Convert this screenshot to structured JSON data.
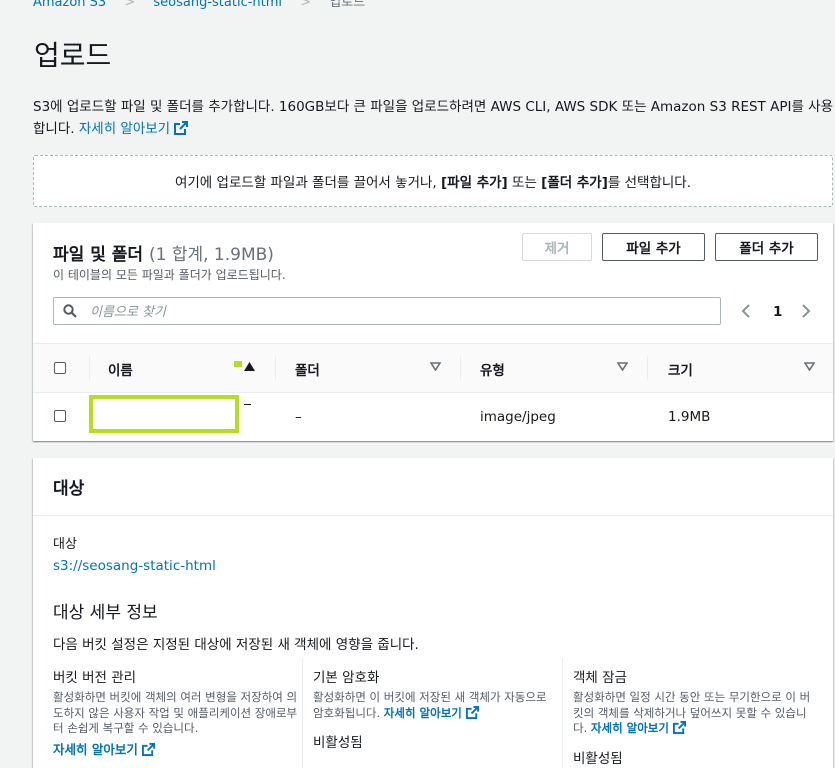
{
  "breadcrumb": {
    "root": "Amazon S3",
    "bucket": "seosang-static-html",
    "current": "업로드"
  },
  "page": {
    "title": "업로드",
    "intro_text": "S3에 업로드할 파일 및 폴더를 추가합니다. 160GB보다 큰 파일을 업로드하려면 AWS CLI, AWS SDK 또는 Amazon S3 REST API를 사용합니다.",
    "intro_link": "자세히 알아보기"
  },
  "dropzone": {
    "part1": "여기에 업로드할 파일과 폴더를 끌어서 놓거나, ",
    "add_files": "[파일 추가]",
    "part2": " 또는 ",
    "add_folder": "[폴더 추가]",
    "part3": "를 선택합니다."
  },
  "files": {
    "title": "파일 및 폴더",
    "count": "(1 합계, 1.9MB)",
    "description": "이 테이블의 모든 파일과 폴더가 업로드됩니다.",
    "buttons": {
      "remove": "제거",
      "add_files": "파일 추가",
      "add_folder": "폴더 추가"
    },
    "search_placeholder": "이름으로 찾기",
    "page": "1",
    "columns": {
      "name": "이름",
      "folder": "폴더",
      "type": "유형",
      "size": "크기"
    },
    "rows": [
      {
        "name": "",
        "folder": "–",
        "type": "image/jpeg",
        "size": "1.9MB"
      }
    ],
    "colors": {
      "highlight": "#b5de1f"
    }
  },
  "target": {
    "header": "대상",
    "label": "대상",
    "uri": "s3://seosang-static-html",
    "details_title": "대상 세부 정보",
    "details_desc": "다음 버킷 설정은 지정된 대상에 저장된 새 객체에 영향을 줍니다.",
    "versioning": {
      "title": "버킷 버전 관리",
      "desc": "활성화하면 버킷에 객체의 여러 변형을 저장하여 의도하지 않은 사용자 작업 및 애플리케이션 장애로부터 손쉽게 복구할 수 있습니다.",
      "link": "자세히 알아보기"
    },
    "encryption": {
      "title": "기본 암호화",
      "desc": "활성화하면 이 버킷에 저장된 새 객체가 자동으로 암호화됩니다.",
      "link": "자세히 알아보기",
      "value": "비활성됨"
    },
    "lock": {
      "title": "객체 잠금",
      "desc": "활성화하면 일정 시간 동안 또는 무기한으로 이 버킷의 객체를 삭제하거나 덮어쓰지 못할 수 있습니다.",
      "link": "자세히 알아보기",
      "value": "비활성됨"
    }
  }
}
